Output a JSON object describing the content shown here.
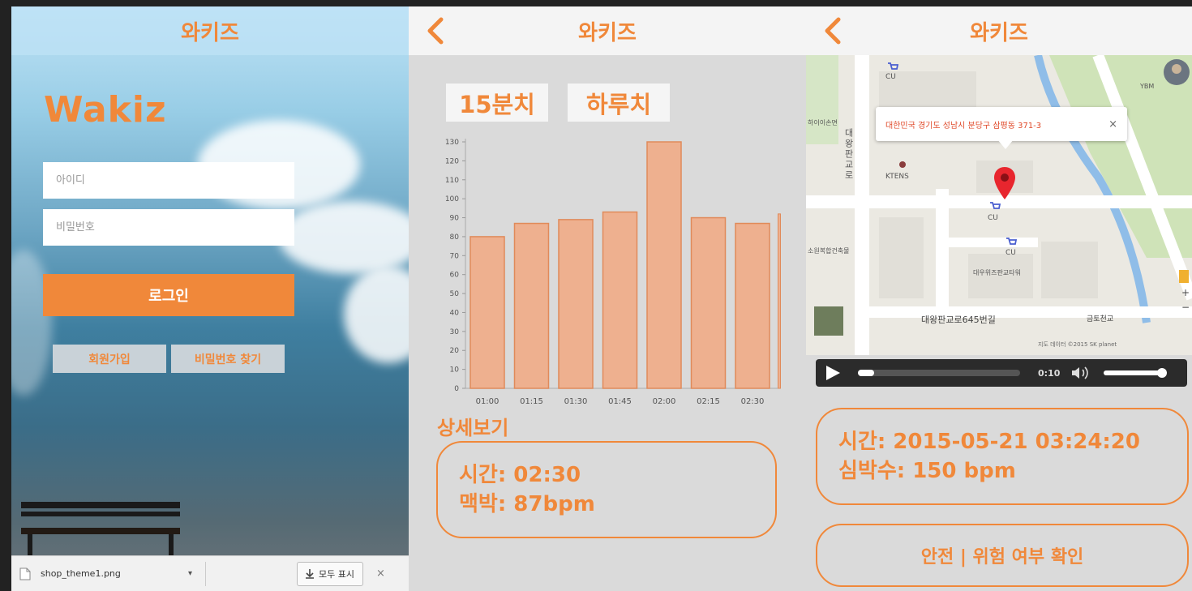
{
  "login": {
    "app_title": "와키즈",
    "brand": "Wakiz",
    "id_placeholder": "아이디",
    "password_placeholder": "비밀번호",
    "login_label": "로그인",
    "signup_label": "회원가입",
    "find_password_label": "비밀번호 찾기"
  },
  "download_bar": {
    "filename": "shop_theme1.png",
    "show_all_label": "모두 표시",
    "close": "×"
  },
  "heart_rate": {
    "app_title": "와키즈",
    "tabs": [
      "15분치",
      "하루치"
    ],
    "detail_link": "상세보기",
    "detail_time": "시간: 02:30",
    "detail_pulse": "맥박: 87bpm"
  },
  "location": {
    "app_title": "와키즈",
    "address": "대한민국 경기도 성남시 분당구 삼평동 371-3",
    "map_labels": {
      "cu": "CU",
      "ktens": "KTENS",
      "daewoo": "대우위즈판교타워",
      "road": "대왕판교로645번길",
      "station": "금토천교",
      "ybm": "YBM",
      "left1": "하이이손면",
      "left2": "소원복합건축물",
      "vertical_road": "대왕판교로",
      "credit": "지도 데이터 ©2015 SK planet"
    },
    "player_time": "0:10",
    "progress": 0.1,
    "volume": 0.95,
    "info_time": "시간: 2015-05-21 03:24:20",
    "info_bpm": "심박수: 150 bpm",
    "confirm_label": "안전 | 위험 여부 확인"
  },
  "colors": {
    "accent": "#f0883a",
    "bar_fill": "#eeb08f",
    "bar_stroke": "#e08a5a"
  },
  "chart_data": {
    "type": "bar",
    "categories": [
      "01:00",
      "01:15",
      "01:30",
      "01:45",
      "02:00",
      "02:15",
      "02:30"
    ],
    "values": [
      80,
      87,
      89,
      93,
      130,
      90,
      87
    ],
    "yticks": [
      0,
      10,
      20,
      30,
      40,
      50,
      60,
      70,
      80,
      90,
      100,
      110,
      120,
      130
    ],
    "ylim": [
      0,
      130
    ],
    "title": "",
    "xlabel": "",
    "ylabel": "",
    "grid": false
  }
}
